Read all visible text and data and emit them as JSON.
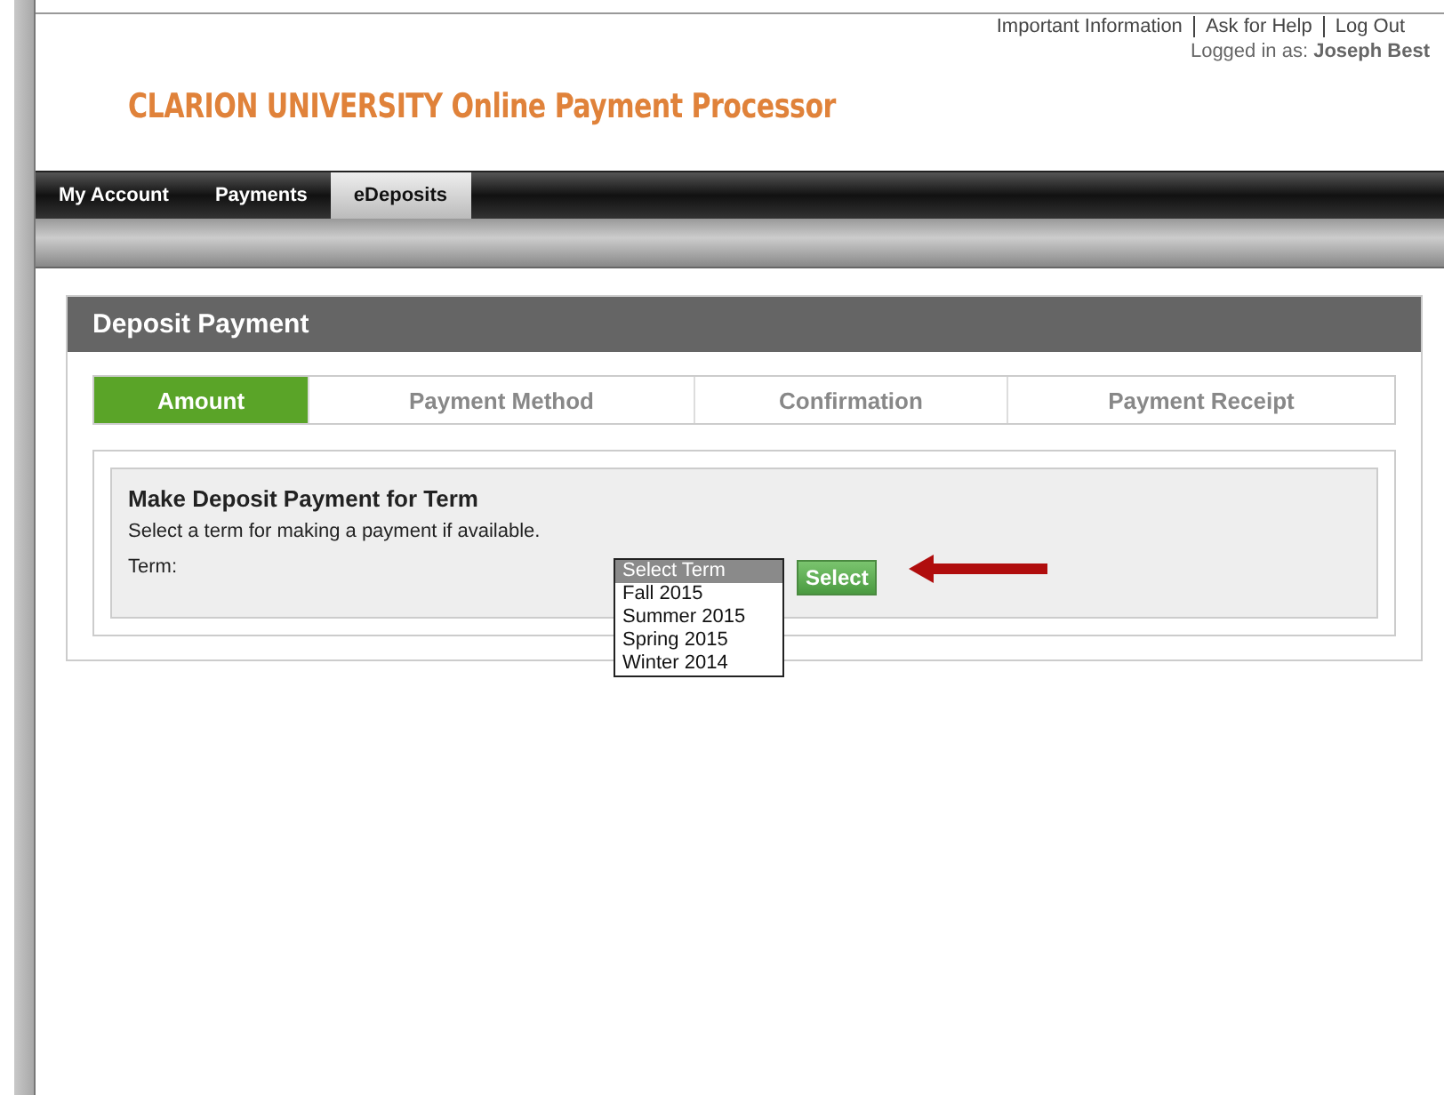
{
  "top_links": [
    "Important Information",
    "Ask for Help",
    "Log Out"
  ],
  "login": {
    "label": "Logged in as:",
    "user": "Joseph Best"
  },
  "logo": "CLARION UNIVERSITY Online Payment Processor",
  "nav": [
    {
      "label": "My Account",
      "selected": false
    },
    {
      "label": "Payments",
      "selected": false
    },
    {
      "label": "eDeposits",
      "selected": true
    }
  ],
  "panel": {
    "title": "Deposit Payment"
  },
  "steps": [
    {
      "label": "Amount",
      "selected": true
    },
    {
      "label": "Payment Method",
      "selected": false
    },
    {
      "label": "Confirmation",
      "selected": false
    },
    {
      "label": "Payment Receipt",
      "selected": false
    }
  ],
  "form": {
    "heading": "Make Deposit Payment for Term",
    "description": "Select a term for making a payment if available.",
    "term_label": "Term:",
    "term_options": [
      {
        "label": "Select Term",
        "selected": true
      },
      {
        "label": "Fall 2015",
        "selected": false
      },
      {
        "label": "Summer 2015",
        "selected": false
      },
      {
        "label": "Spring 2015",
        "selected": false
      },
      {
        "label": "Winter 2014",
        "selected": false
      }
    ],
    "button": "Select"
  }
}
